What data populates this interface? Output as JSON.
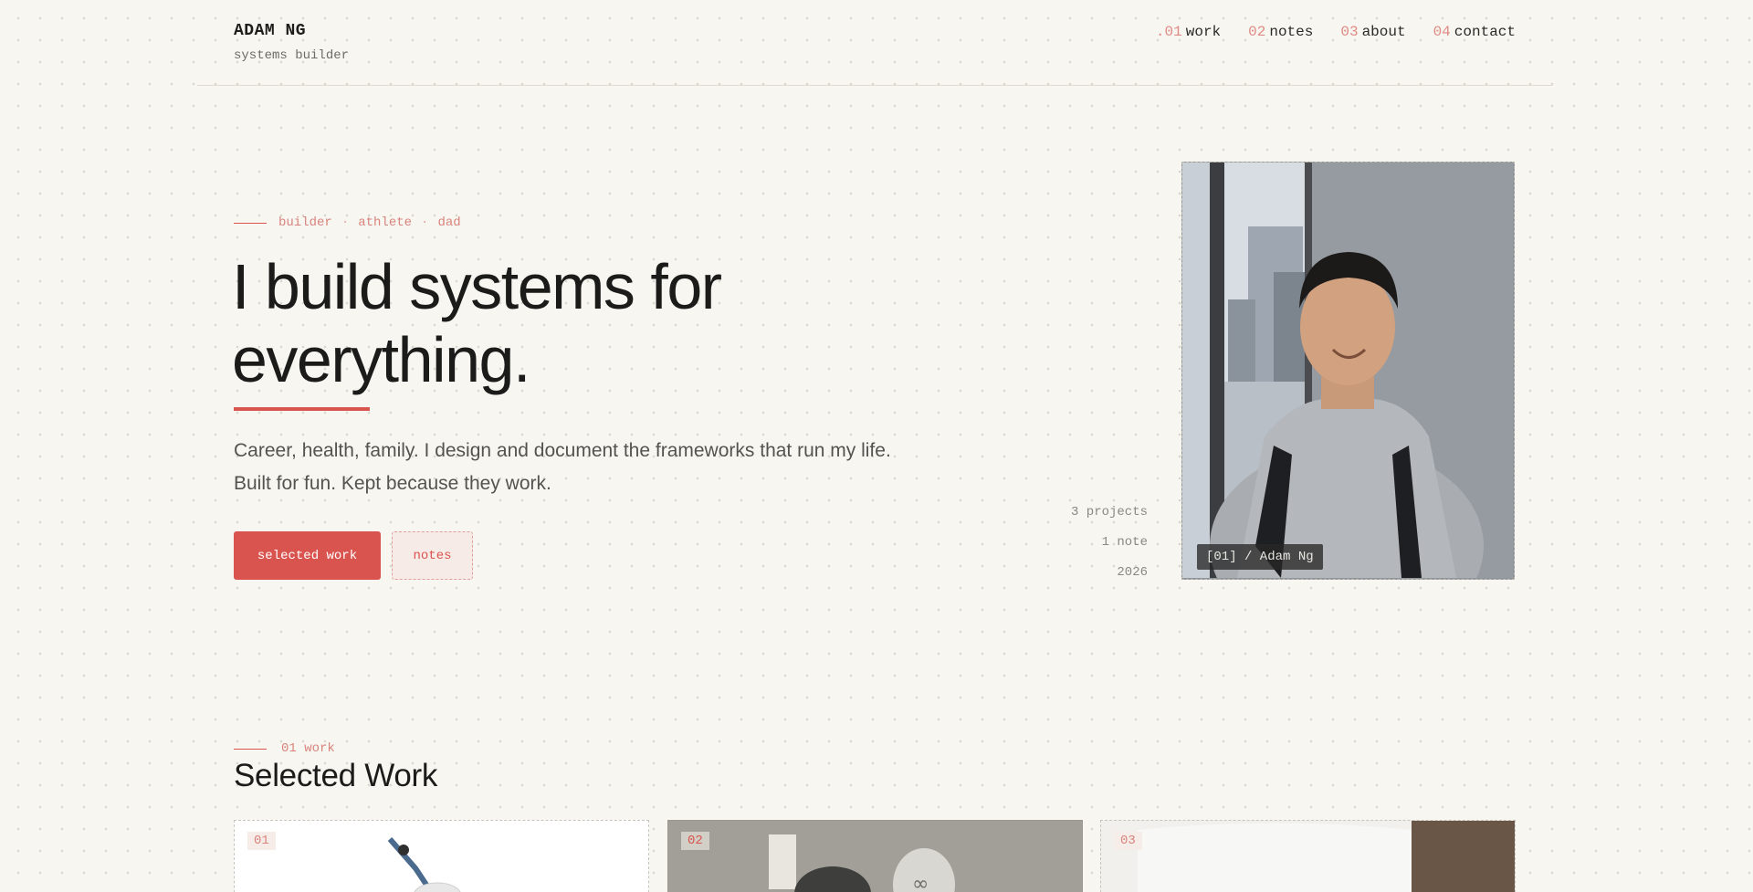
{
  "header": {
    "name": "ADAM NG",
    "tagline": "systems builder",
    "nav": [
      {
        "num": ".01",
        "label": "work"
      },
      {
        "num": "02",
        "label": "notes"
      },
      {
        "num": "03",
        "label": "about"
      },
      {
        "num": "04",
        "label": "contact"
      }
    ]
  },
  "hero": {
    "eyebrow": [
      "builder",
      "athlete",
      "dad"
    ],
    "eyebrow_sep": "·",
    "title_line1": "I build systems for",
    "title_line2": "everything.",
    "subtitle_line1": "Career, health, family. I design and document the frameworks that run my life.",
    "subtitle_line2": "Built for fun. Kept because they work.",
    "primary_button": "selected work",
    "secondary_button": "notes",
    "stats": [
      "3 projects",
      "1 note",
      "2026"
    ],
    "portrait_caption": "[01] / Adam Ng"
  },
  "work": {
    "eyebrow": "01 work",
    "title": "Selected Work",
    "cards": [
      {
        "num": "01"
      },
      {
        "num": "02"
      },
      {
        "num": "03"
      }
    ]
  },
  "colors": {
    "accent": "#d9534f",
    "background": "#f7f6f1",
    "text": "#1b1b1a",
    "muted": "#8a8882"
  }
}
